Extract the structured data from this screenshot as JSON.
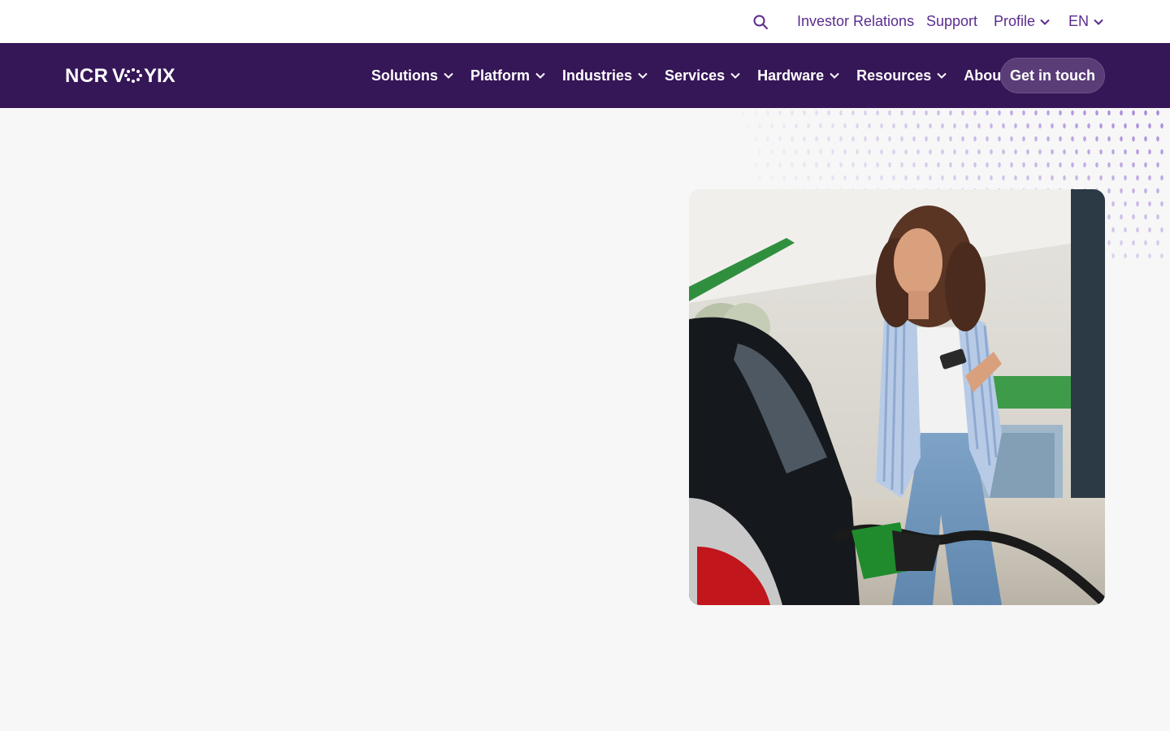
{
  "utility": {
    "search_icon": "search-icon",
    "links": [
      {
        "label": "Investor Relations"
      },
      {
        "label": "Support"
      },
      {
        "label": "Profile"
      },
      {
        "label": "EN"
      }
    ]
  },
  "brand": {
    "logo_text": "NCR VOYIX",
    "accent": "#5b2c8f",
    "nav_bg": "#351657"
  },
  "nav": {
    "items": [
      {
        "label": "Solutions"
      },
      {
        "label": "Platform"
      },
      {
        "label": "Industries"
      },
      {
        "label": "Services"
      },
      {
        "label": "Hardware"
      },
      {
        "label": "Resources"
      },
      {
        "label": "About"
      }
    ],
    "cta_label": "Get in touch"
  },
  "hero": {
    "image_subject": "woman-refueling-car-with-phone"
  }
}
